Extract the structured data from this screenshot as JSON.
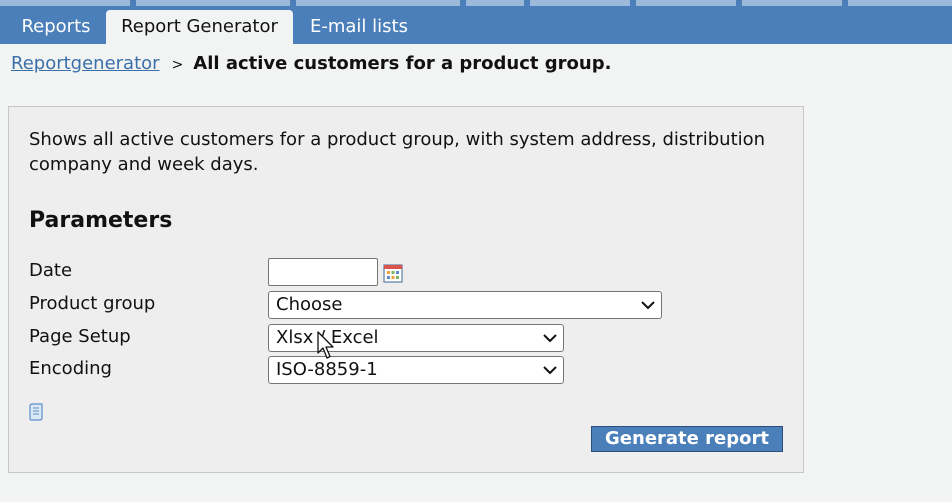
{
  "tabs": [
    {
      "label": "Reports",
      "active": false
    },
    {
      "label": "Report Generator",
      "active": true
    },
    {
      "label": "E-mail lists",
      "active": false
    }
  ],
  "breadcrumb": {
    "link": "Reportgenerator",
    "separator": ">",
    "current": "All active customers for a product group."
  },
  "panel": {
    "description": "Shows all active customers for a product group, with system address, distribution company and week days.",
    "parameters_title": "Parameters",
    "fields": {
      "date_label": "Date",
      "date_value": "",
      "product_group_label": "Product group",
      "product_group_value": "Choose",
      "page_setup_label": "Page Setup",
      "page_setup_value": "Xlsx / Excel",
      "encoding_label": "Encoding",
      "encoding_value": "ISO-8859-1"
    },
    "generate_button": "Generate report"
  },
  "colors": {
    "accent": "#4a7fba",
    "link": "#3b6fa8",
    "panel_bg": "#eeeeee",
    "page_bg": "#f2f4f3"
  }
}
